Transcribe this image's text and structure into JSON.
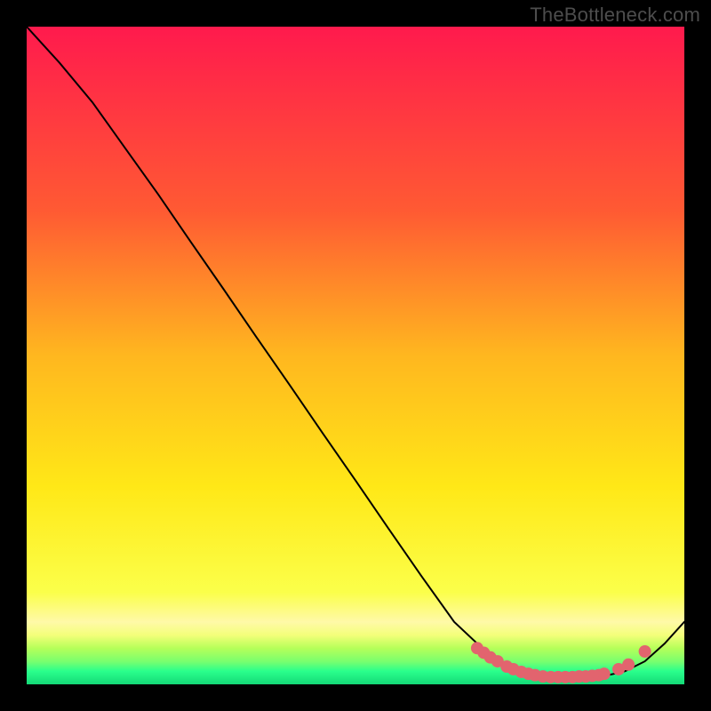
{
  "watermark": "TheBottleneck.com",
  "chart_data": {
    "type": "line",
    "title": "",
    "xlabel": "",
    "ylabel": "",
    "xlim": [
      0,
      1
    ],
    "ylim": [
      0,
      1
    ],
    "grid": false,
    "background_gradient": {
      "top_color": "#ff1a4d",
      "mid1_color": "#ff8a2a",
      "mid2_color": "#ffe817",
      "band1_color": "#fff9a8",
      "band2_color": "#f4ff7a",
      "band3_color": "#b6ff59",
      "bottom_color": "#2aff8c",
      "very_bottom_color": "#14d977"
    },
    "series": [
      {
        "name": "bottleneck-curve",
        "color": "#000000",
        "stroke_width": 2,
        "x": [
          0.0,
          0.05,
          0.1,
          0.15,
          0.2,
          0.25,
          0.3,
          0.35,
          0.4,
          0.45,
          0.5,
          0.55,
          0.6,
          0.65,
          0.7,
          0.73,
          0.76,
          0.8,
          0.84,
          0.88,
          0.91,
          0.94,
          0.97,
          1.0
        ],
        "y": [
          1.0,
          0.945,
          0.885,
          0.815,
          0.745,
          0.672,
          0.6,
          0.527,
          0.455,
          0.382,
          0.31,
          0.237,
          0.165,
          0.095,
          0.048,
          0.028,
          0.018,
          0.012,
          0.011,
          0.013,
          0.02,
          0.035,
          0.062,
          0.095
        ]
      },
      {
        "name": "data-points",
        "color": "#e2646e",
        "marker": "circle",
        "radius": 7,
        "x": [
          0.685,
          0.695,
          0.705,
          0.716,
          0.73,
          0.74,
          0.752,
          0.763,
          0.773,
          0.785,
          0.797,
          0.808,
          0.819,
          0.83,
          0.84,
          0.85,
          0.86,
          0.87,
          0.878,
          0.9,
          0.915,
          0.94
        ],
        "y": [
          0.055,
          0.048,
          0.041,
          0.035,
          0.027,
          0.023,
          0.019,
          0.016,
          0.014,
          0.012,
          0.011,
          0.011,
          0.011,
          0.011,
          0.012,
          0.012,
          0.013,
          0.014,
          0.016,
          0.023,
          0.03,
          0.05
        ]
      }
    ]
  }
}
